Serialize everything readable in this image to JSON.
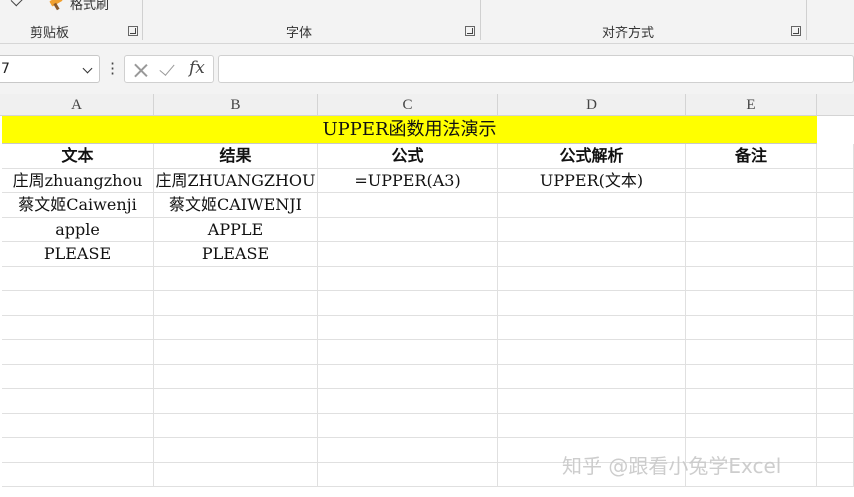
{
  "ribbon": {
    "format_painter_label": "格式刷",
    "groups": [
      "剪贴板",
      "字体",
      "对齐方式"
    ]
  },
  "formula_bar": {
    "name_box": "7",
    "formula": "",
    "fx_label": "fx"
  },
  "sheet": {
    "columns": [
      "A",
      "B",
      "C",
      "D",
      "E"
    ],
    "title": "UPPER函数用法演示",
    "title_bg": "#ffff00",
    "headers": [
      "文本",
      "结果",
      "公式",
      "公式解析",
      "备注"
    ],
    "rows": [
      [
        "庄周zhuangzhou",
        "庄周ZHUANGZHOU",
        "=UPPER(A3)",
        "UPPER(文本)",
        ""
      ],
      [
        "蔡文姬Caiwenji",
        "蔡文姬CAIWENJI",
        "",
        "",
        ""
      ],
      [
        "apple",
        "APPLE",
        "",
        "",
        ""
      ],
      [
        "PLEASE",
        "PLEASE",
        "",
        "",
        ""
      ]
    ]
  },
  "watermark": "知乎 @跟看小兔学Excel"
}
